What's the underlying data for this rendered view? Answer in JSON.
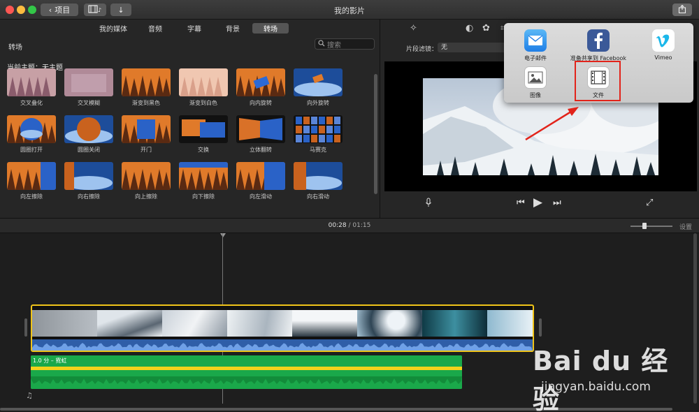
{
  "window": {
    "title": "我的影片",
    "back_button_label": "项目",
    "colors": {
      "close": "#fc5753",
      "minimize": "#fdbc40",
      "zoom": "#33c748"
    }
  },
  "browser": {
    "tabs": [
      {
        "label": "我的媒体",
        "active": false
      },
      {
        "label": "音频",
        "active": false
      },
      {
        "label": "字幕",
        "active": false
      },
      {
        "label": "背景",
        "active": false
      },
      {
        "label": "转场",
        "active": true
      }
    ],
    "section_title": "转场",
    "search_placeholder": "搜索",
    "theme_label": "当前主题：",
    "theme_value": "无主题",
    "transitions": [
      {
        "label": "交叉叠化",
        "style": "pink"
      },
      {
        "label": "交叉模糊",
        "style": "blur"
      },
      {
        "label": "渐变到黑色",
        "style": "forest"
      },
      {
        "label": "渐变到白色",
        "style": "white"
      },
      {
        "label": "向内旋转",
        "style": "spin"
      },
      {
        "label": "向外旋转",
        "style": "spinout"
      },
      {
        "label": "圆圈打开",
        "style": "circleopen"
      },
      {
        "label": "圆圈关闭",
        "style": "circleclose"
      },
      {
        "label": "开门",
        "style": "door"
      },
      {
        "label": "交换",
        "style": "swap"
      },
      {
        "label": "立体翻转",
        "style": "cube"
      },
      {
        "label": "马赛克",
        "style": "mosaic"
      },
      {
        "label": "向左擦除",
        "style": "wipel"
      },
      {
        "label": "向右擦除",
        "style": "wiper"
      },
      {
        "label": "向上擦除",
        "style": "forest"
      },
      {
        "label": "向下擦除",
        "style": "wipedown"
      },
      {
        "label": "向左滑动",
        "style": "slidel"
      },
      {
        "label": "向右滑动",
        "style": "slider"
      }
    ]
  },
  "viewer": {
    "clip_filter_label": "片段滤镜：",
    "clip_filter_value": "无"
  },
  "share_menu": {
    "items": [
      {
        "label": "电子邮件",
        "icon": "mail-icon"
      },
      {
        "label": "准备共享到 Facebook",
        "icon": "facebook-icon"
      },
      {
        "label": "Vimeo",
        "icon": "vimeo-icon"
      },
      {
        "label": "图像",
        "icon": "image-icon"
      },
      {
        "label": "文件",
        "icon": "film-icon"
      }
    ]
  },
  "timeline": {
    "current_time": "00:28",
    "separator": " / ",
    "total_time": "01:15",
    "settings_label": "设置",
    "music_label": "1.0 分 – 霓虹"
  },
  "watermark": {
    "brand": "Bai du 经验",
    "url": "jingyan.baidu.com"
  }
}
